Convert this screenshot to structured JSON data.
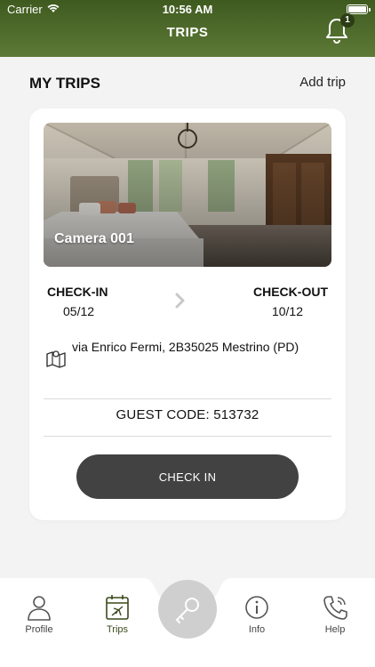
{
  "status_bar": {
    "carrier": "Carrier",
    "time": "10:56 AM"
  },
  "header": {
    "title": "TRIPS",
    "notification_count": "1"
  },
  "section": {
    "title": "MY TRIPS",
    "add_label": "Add trip"
  },
  "trip": {
    "room_name": "Camera 001",
    "checkin_label": "CHECK-IN",
    "checkin_date": "05/12",
    "checkout_label": "CHECK-OUT",
    "checkout_date": "10/12",
    "address": "via Enrico Fermi, 2B35025 Mestrino (PD)",
    "guest_code": "GUEST CODE: 513732",
    "action_label": "CHECK IN"
  },
  "tabs": [
    {
      "label": "Profile",
      "icon": "person-icon"
    },
    {
      "label": "Trips",
      "icon": "calendar-plane-icon",
      "active": true
    },
    {
      "label": "",
      "icon": "key-icon"
    },
    {
      "label": "Info",
      "icon": "info-icon"
    },
    {
      "label": "Help",
      "icon": "phone-icon"
    }
  ],
  "colors": {
    "header_dark": "#3f5a1f",
    "header_light": "#5d7a37",
    "button": "#424242",
    "active_tab": "#3a4a1c"
  }
}
